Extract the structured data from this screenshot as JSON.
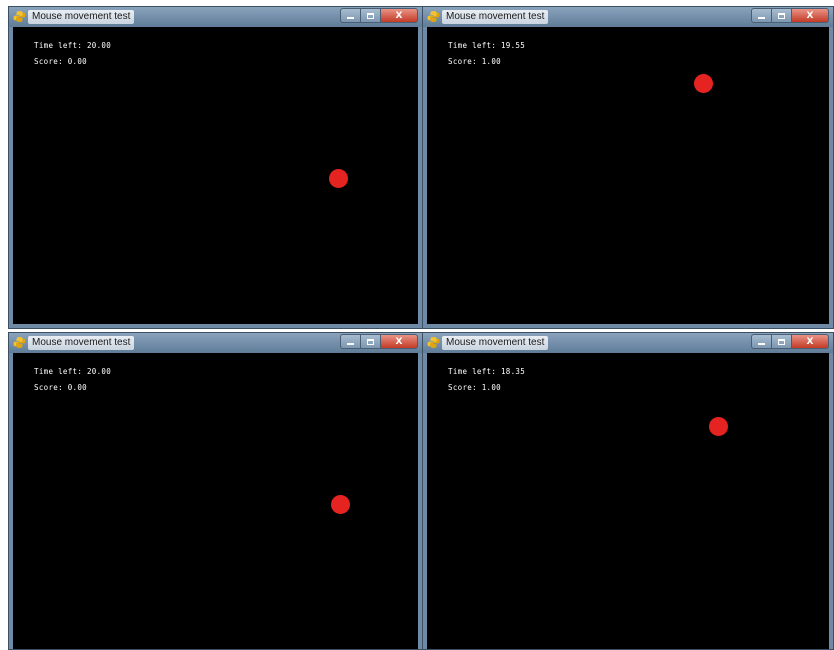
{
  "windows": [
    {
      "title": "Mouse movement test",
      "time_left": "Time left: 20.00",
      "score": "Score: 0.00",
      "buttons": {
        "minimize": "_",
        "maximize": "",
        "close": "X"
      }
    },
    {
      "title": "Mouse movement test",
      "time_left": "Time left: 19.55",
      "score": "Score: 1.00",
      "buttons": {
        "minimize": "_",
        "maximize": "",
        "close": "X"
      }
    },
    {
      "title": "Mouse movement test",
      "time_left": "Time left: 20.00",
      "score": "Score: 0.00",
      "buttons": {
        "minimize": "_",
        "maximize": "",
        "close": "X"
      }
    },
    {
      "title": "Mouse movement test",
      "time_left": "Time left: 18.35",
      "score": "Score: 1.00",
      "buttons": {
        "minimize": "_",
        "maximize": "",
        "close": "X"
      }
    }
  ],
  "colors": {
    "target": "#e52421",
    "game_background": "#000000",
    "hud_text": "#ffffff"
  },
  "icons": {
    "app": "python-icon",
    "minimize": "minimize-icon",
    "maximize": "maximize-icon",
    "close": "close-icon"
  }
}
